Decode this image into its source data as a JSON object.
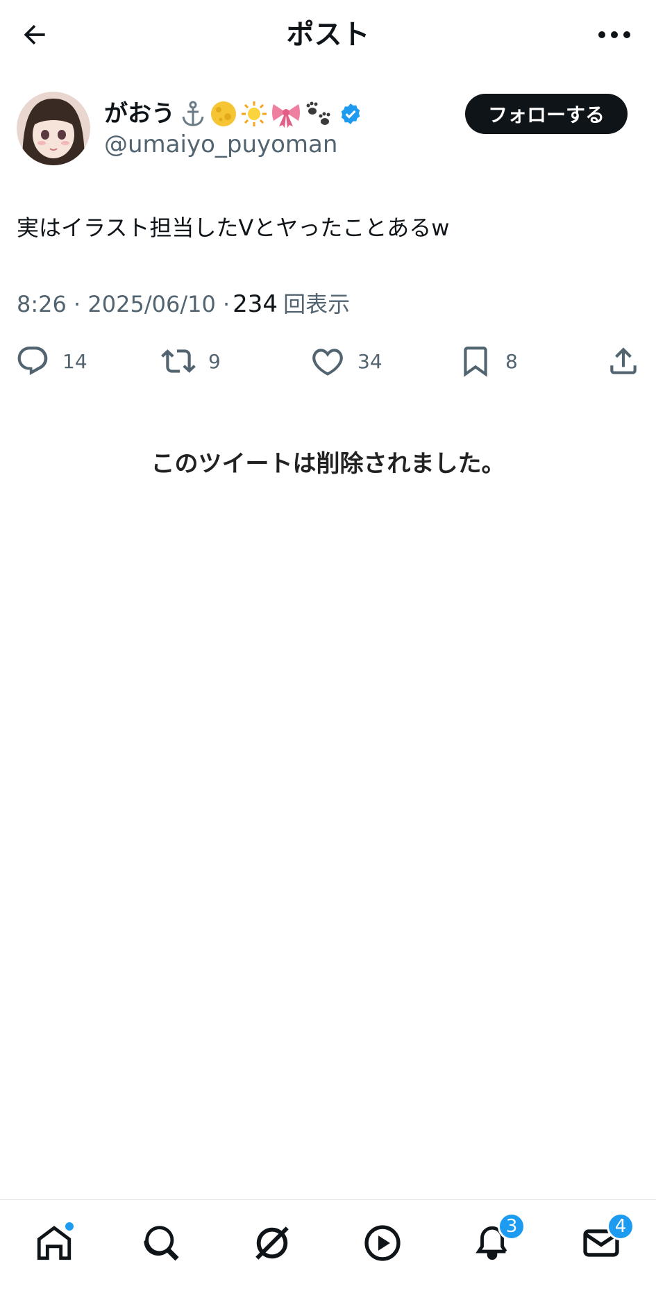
{
  "header": {
    "title": "ポスト"
  },
  "user": {
    "display_name": "がおう",
    "handle": "@umaiyo_puyoman",
    "follow_label": "フォローする",
    "emojis": [
      "⚓",
      "🌕",
      "☀",
      "🎀",
      "🐾"
    ]
  },
  "post": {
    "text": "実はイラスト担当したVとヤったことあるw",
    "time": "8:26",
    "date": "2025/06/10",
    "views_count": "234",
    "views_label": "回表示"
  },
  "stats": {
    "replies": "14",
    "reposts": "9",
    "likes": "34",
    "bookmarks": "8"
  },
  "deleted_message": "このツイートは削除されました。",
  "nav": {
    "notifications_badge": "3",
    "messages_badge": "4"
  },
  "colors": {
    "accent": "#1d9bf0",
    "text": "#0f1419",
    "secondary": "#536471"
  }
}
